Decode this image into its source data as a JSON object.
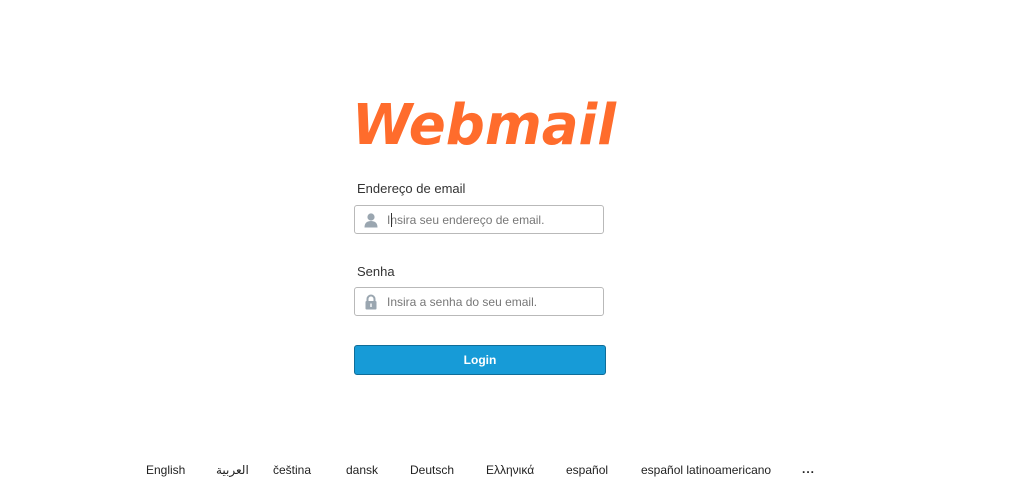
{
  "logo": {
    "text": "Webmail",
    "color": "#ff6c2c"
  },
  "form": {
    "email": {
      "label": "Endereço de email",
      "placeholder": "Insira seu endereço de email.",
      "value": "",
      "icon": "user-icon"
    },
    "password": {
      "label": "Senha",
      "placeholder": "Insira a senha do seu email.",
      "value": "",
      "icon": "lock-icon"
    },
    "login_label": "Login"
  },
  "languages": [
    "English",
    "العربية",
    "čeština",
    "dansk",
    "Deutsch",
    "Ελληνικά",
    "español",
    "español latinoamericano"
  ],
  "languages_more": "...",
  "colors": {
    "accent": "#179bd7",
    "input_border": "#b9b9b9",
    "icon": "#9aa6b0"
  }
}
